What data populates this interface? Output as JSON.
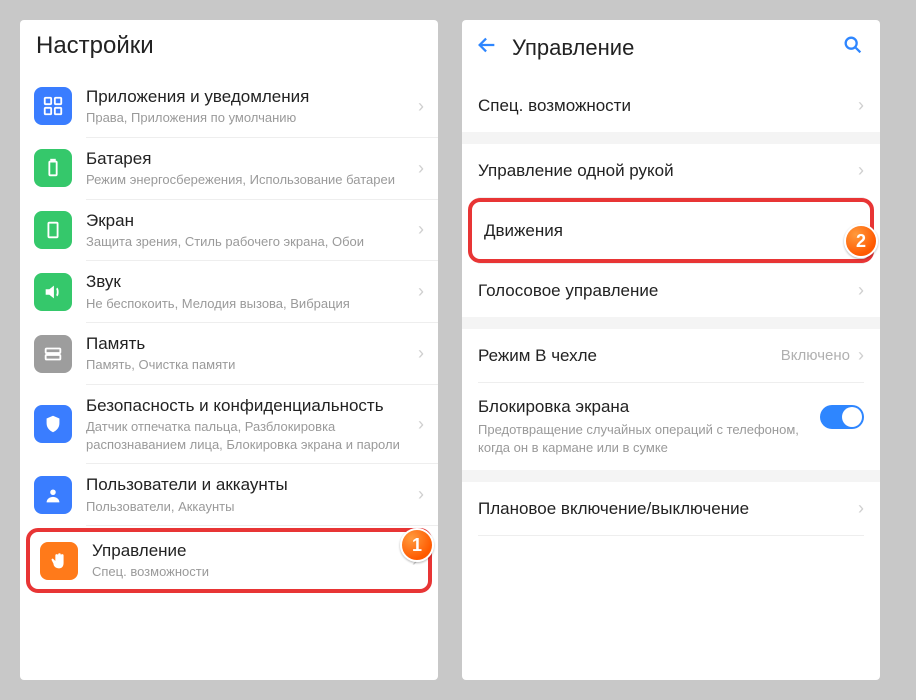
{
  "left": {
    "header": "Настройки",
    "items": [
      {
        "title": "Приложения и уведомления",
        "sub": "Права, Приложения по умолчанию"
      },
      {
        "title": "Батарея",
        "sub": "Режим энергосбережения, Использование батареи"
      },
      {
        "title": "Экран",
        "sub": "Защита зрения, Стиль рабочего экрана, Обои"
      },
      {
        "title": "Звук",
        "sub": "Не беспокоить, Мелодия вызова, Вибрация"
      },
      {
        "title": "Память",
        "sub": "Память, Очистка памяти"
      },
      {
        "title": "Безопасность и конфиденциальность",
        "sub": "Датчик отпечатка пальца, Разблокировка распознаванием лица, Блокировка экрана и пароли"
      },
      {
        "title": "Пользователи и аккаунты",
        "sub": "Пользователи, Аккаунты"
      },
      {
        "title": "Управление",
        "sub": "Спец. возможности"
      }
    ],
    "badge": "1"
  },
  "right": {
    "title": "Управление",
    "items": {
      "accessibility": "Спец. возможности",
      "one_hand": "Управление одной рукой",
      "motions": "Движения",
      "voice": "Голосовое управление",
      "case_mode": {
        "title": "Режим В чехле",
        "value": "Включено"
      },
      "screen_lock": {
        "title": "Блокировка экрана",
        "sub": "Предотвращение случайных операций с телефоном, когда он в кармане или в сумке"
      },
      "scheduled": "Плановое включение/выключение"
    },
    "badge": "2"
  }
}
